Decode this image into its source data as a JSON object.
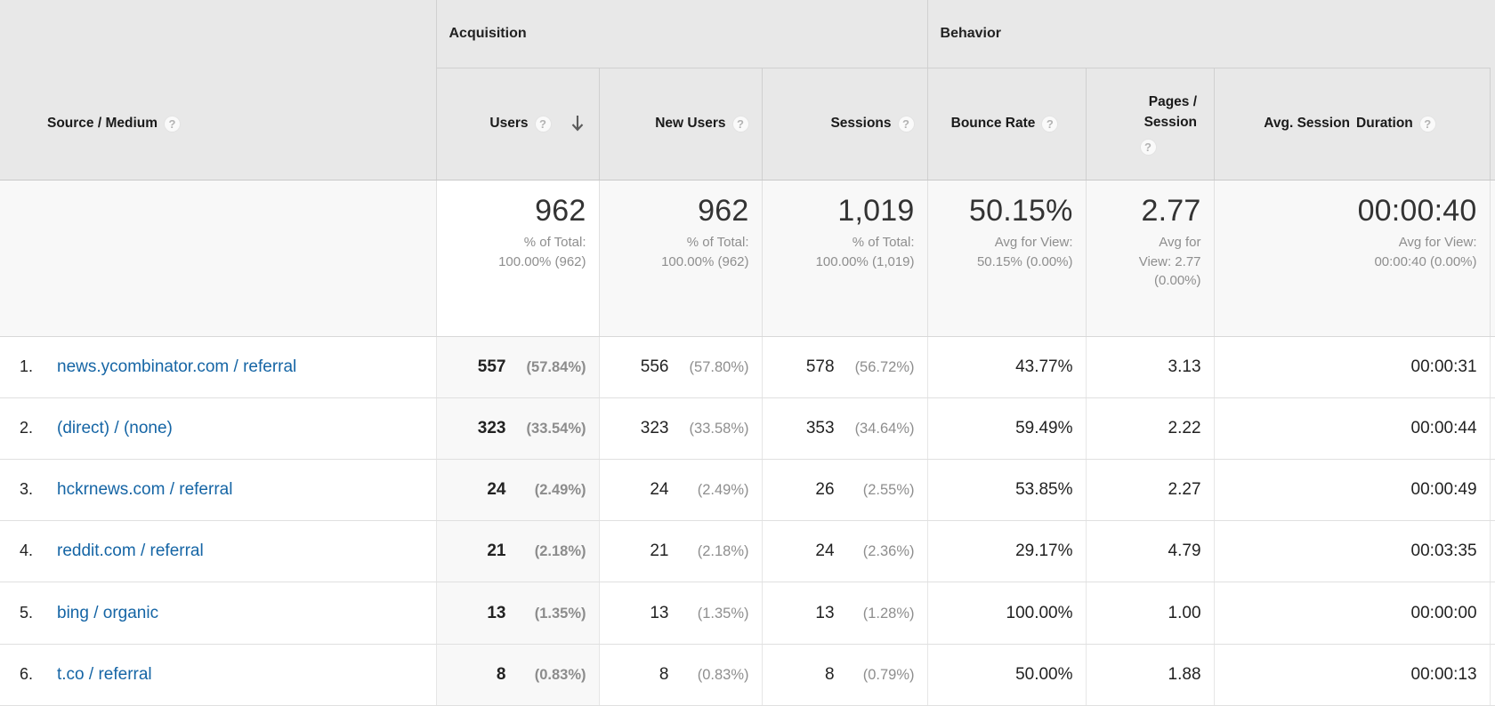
{
  "table": {
    "dimension_header": {
      "label": "Source / Medium",
      "help_icon": "help-question-icon"
    },
    "groups": [
      {
        "id": "acquisition",
        "label": "Acquisition"
      },
      {
        "id": "behavior",
        "label": "Behavior"
      }
    ],
    "columns": [
      {
        "id": "users",
        "label": "Users",
        "help_icon": "help-question-icon",
        "sorted": true,
        "sort_icon": "arrow-down-icon",
        "sort_direction": "descending"
      },
      {
        "id": "new_users",
        "label": "New Users",
        "help_icon": "help-question-icon",
        "sorted": false
      },
      {
        "id": "sessions",
        "label": "Sessions",
        "help_icon": "help-question-icon",
        "sorted": false
      },
      {
        "id": "bounce_rate",
        "label": "Bounce Rate",
        "help_icon": "help-question-icon",
        "sorted": false
      },
      {
        "id": "pages_session",
        "label": "Pages / Session",
        "help_icon": "help-question-icon",
        "sorted": false
      },
      {
        "id": "avg_session_duration",
        "label_line1": "Avg. Session",
        "label_line2": "Duration",
        "help_icon": "help-question-icon",
        "sorted": false
      }
    ],
    "summary": {
      "users": {
        "value": "962",
        "note_line1": "% of Total:",
        "note_line2": "100.00% (962)"
      },
      "new_users": {
        "value": "962",
        "note_line1": "% of Total:",
        "note_line2": "100.00% (962)"
      },
      "sessions": {
        "value": "1,019",
        "note_line1": "% of Total:",
        "note_line2": "100.00% (1,019)"
      },
      "bounce_rate": {
        "value": "50.15%",
        "note_line1": "Avg for View:",
        "note_line2": "50.15% (0.00%)"
      },
      "pages_session": {
        "value": "2.77",
        "note_line1": "Avg for",
        "note_line2": "View: 2.77",
        "note_line3": "(0.00%)"
      },
      "avg_session_duration": {
        "value": "00:00:40",
        "note_line1": "Avg for View:",
        "note_line2": "00:00:40 (0.00%)"
      }
    },
    "rows": [
      {
        "rank": "1.",
        "source": "news.ycombinator.com / referral",
        "users": "557",
        "users_pct": "(57.84%)",
        "new_users": "556",
        "new_users_pct": "(57.80%)",
        "sessions": "578",
        "sessions_pct": "(56.72%)",
        "bounce_rate": "43.77%",
        "pages_session": "3.13",
        "avg_session_duration": "00:00:31"
      },
      {
        "rank": "2.",
        "source": "(direct) / (none)",
        "users": "323",
        "users_pct": "(33.54%)",
        "new_users": "323",
        "new_users_pct": "(33.58%)",
        "sessions": "353",
        "sessions_pct": "(34.64%)",
        "bounce_rate": "59.49%",
        "pages_session": "2.22",
        "avg_session_duration": "00:00:44"
      },
      {
        "rank": "3.",
        "source": "hckrnews.com / referral",
        "users": "24",
        "users_pct": "(2.49%)",
        "new_users": "24",
        "new_users_pct": "(2.49%)",
        "sessions": "26",
        "sessions_pct": "(2.55%)",
        "bounce_rate": "53.85%",
        "pages_session": "2.27",
        "avg_session_duration": "00:00:49"
      },
      {
        "rank": "4.",
        "source": "reddit.com / referral",
        "users": "21",
        "users_pct": "(2.18%)",
        "new_users": "21",
        "new_users_pct": "(2.18%)",
        "sessions": "24",
        "sessions_pct": "(2.36%)",
        "bounce_rate": "29.17%",
        "pages_session": "4.79",
        "avg_session_duration": "00:03:35"
      },
      {
        "rank": "5.",
        "source": "bing / organic",
        "users": "13",
        "users_pct": "(1.35%)",
        "new_users": "13",
        "new_users_pct": "(1.35%)",
        "sessions": "13",
        "sessions_pct": "(1.28%)",
        "bounce_rate": "100.00%",
        "pages_session": "1.00",
        "avg_session_duration": "00:00:00"
      },
      {
        "rank": "6.",
        "source": "t.co / referral",
        "users": "8",
        "users_pct": "(0.83%)",
        "new_users": "8",
        "new_users_pct": "(0.83%)",
        "sessions": "8",
        "sessions_pct": "(0.79%)",
        "bounce_rate": "50.00%",
        "pages_session": "1.88",
        "avg_session_duration": "00:00:13"
      }
    ],
    "icons": {
      "help": "?"
    },
    "colors": {
      "link": "#1565a5",
      "header_bg": "#e8e8e8",
      "summary_bg": "#f8f8f8",
      "sorted_column_bg": "#f8f8f8",
      "muted_text": "#8e8e8e",
      "body_text": "#222222"
    }
  }
}
